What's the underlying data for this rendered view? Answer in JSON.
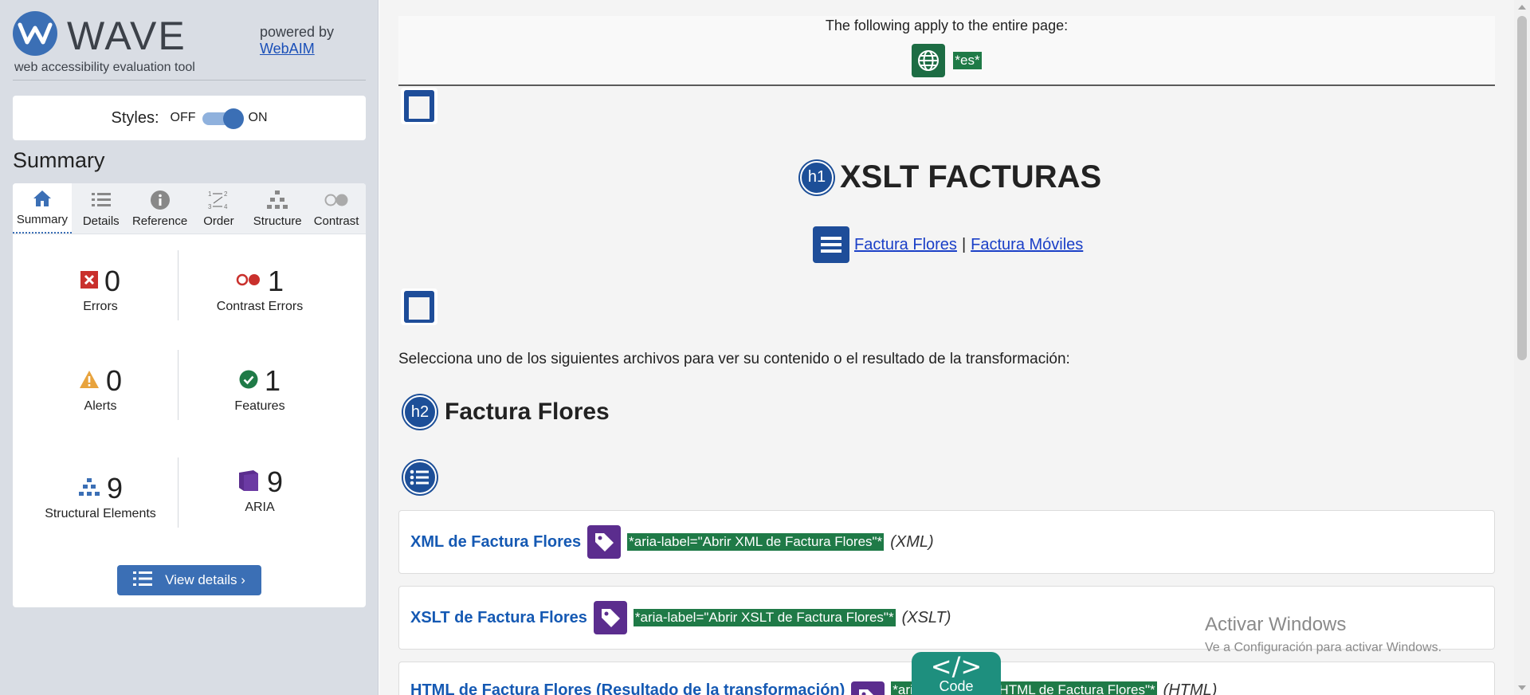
{
  "sidebar": {
    "logo_text": "WAVE",
    "tagline": "web accessibility evaluation tool",
    "powered_by": "powered by",
    "powered_link": "WebAIM",
    "styles_label": "Styles:",
    "toggle_off": "OFF",
    "toggle_on": "ON",
    "toggle_state": "on",
    "summary_heading": "Summary",
    "tabs": [
      {
        "label": "Summary",
        "icon": "home-icon",
        "active": true
      },
      {
        "label": "Details",
        "icon": "list-icon"
      },
      {
        "label": "Reference",
        "icon": "info-icon"
      },
      {
        "label": "Order",
        "icon": "order-icon"
      },
      {
        "label": "Structure",
        "icon": "structure-icon"
      },
      {
        "label": "Contrast",
        "icon": "contrast-icon"
      }
    ],
    "stats": {
      "errors": {
        "count": "0",
        "label": "Errors"
      },
      "contrast_errors": {
        "count": "1",
        "label": "Contrast Errors"
      },
      "alerts": {
        "count": "0",
        "label": "Alerts"
      },
      "features": {
        "count": "1",
        "label": "Features"
      },
      "structural": {
        "count": "9",
        "label": "Structural Elements"
      },
      "aria": {
        "count": "9",
        "label": "ARIA"
      }
    },
    "view_details": "View details ›"
  },
  "main": {
    "entire_page_text": "The following apply to the entire page:",
    "lang_tag": "*es*",
    "h1_badge": "h1",
    "h1_title": "XSLT FACTURAS",
    "nav_links": [
      "Factura Flores",
      "Factura Móviles"
    ],
    "nav_separator": "|",
    "intro": "Selecciona uno de los siguientes archivos para ver su contenido o el resultado de la transformación:",
    "h2_badge": "h2",
    "h2_title": "Factura Flores",
    "items": [
      {
        "link": "XML de Factura Flores",
        "aria": "*aria-label=\"Abrir XML de Factura Flores\"*",
        "type": "(XML)"
      },
      {
        "link": "XSLT de Factura Flores",
        "aria": "*aria-label=\"Abrir XSLT de Factura Flores\"*",
        "type": "(XSLT)"
      },
      {
        "link": "HTML de Factura Flores (Resultado de la transformación)",
        "aria": "*aria-label=\"Abrir HTML de Factura Flores\"*",
        "type": "(HTML)"
      }
    ],
    "watermark_title": "Activar Windows",
    "watermark_sub": "Ve a Configuración para activar Windows.",
    "code_glyph": "</>",
    "code_label": "Code"
  },
  "colors": {
    "wave_blue": "#3b6fb5",
    "feature_green": "#1f7a47",
    "aria_purple": "#5b2d8e",
    "structure_navy": "#1d4f98",
    "code_teal": "#1e8f7e",
    "error_red": "#c9302c",
    "alert_orange": "#e8a33d"
  }
}
